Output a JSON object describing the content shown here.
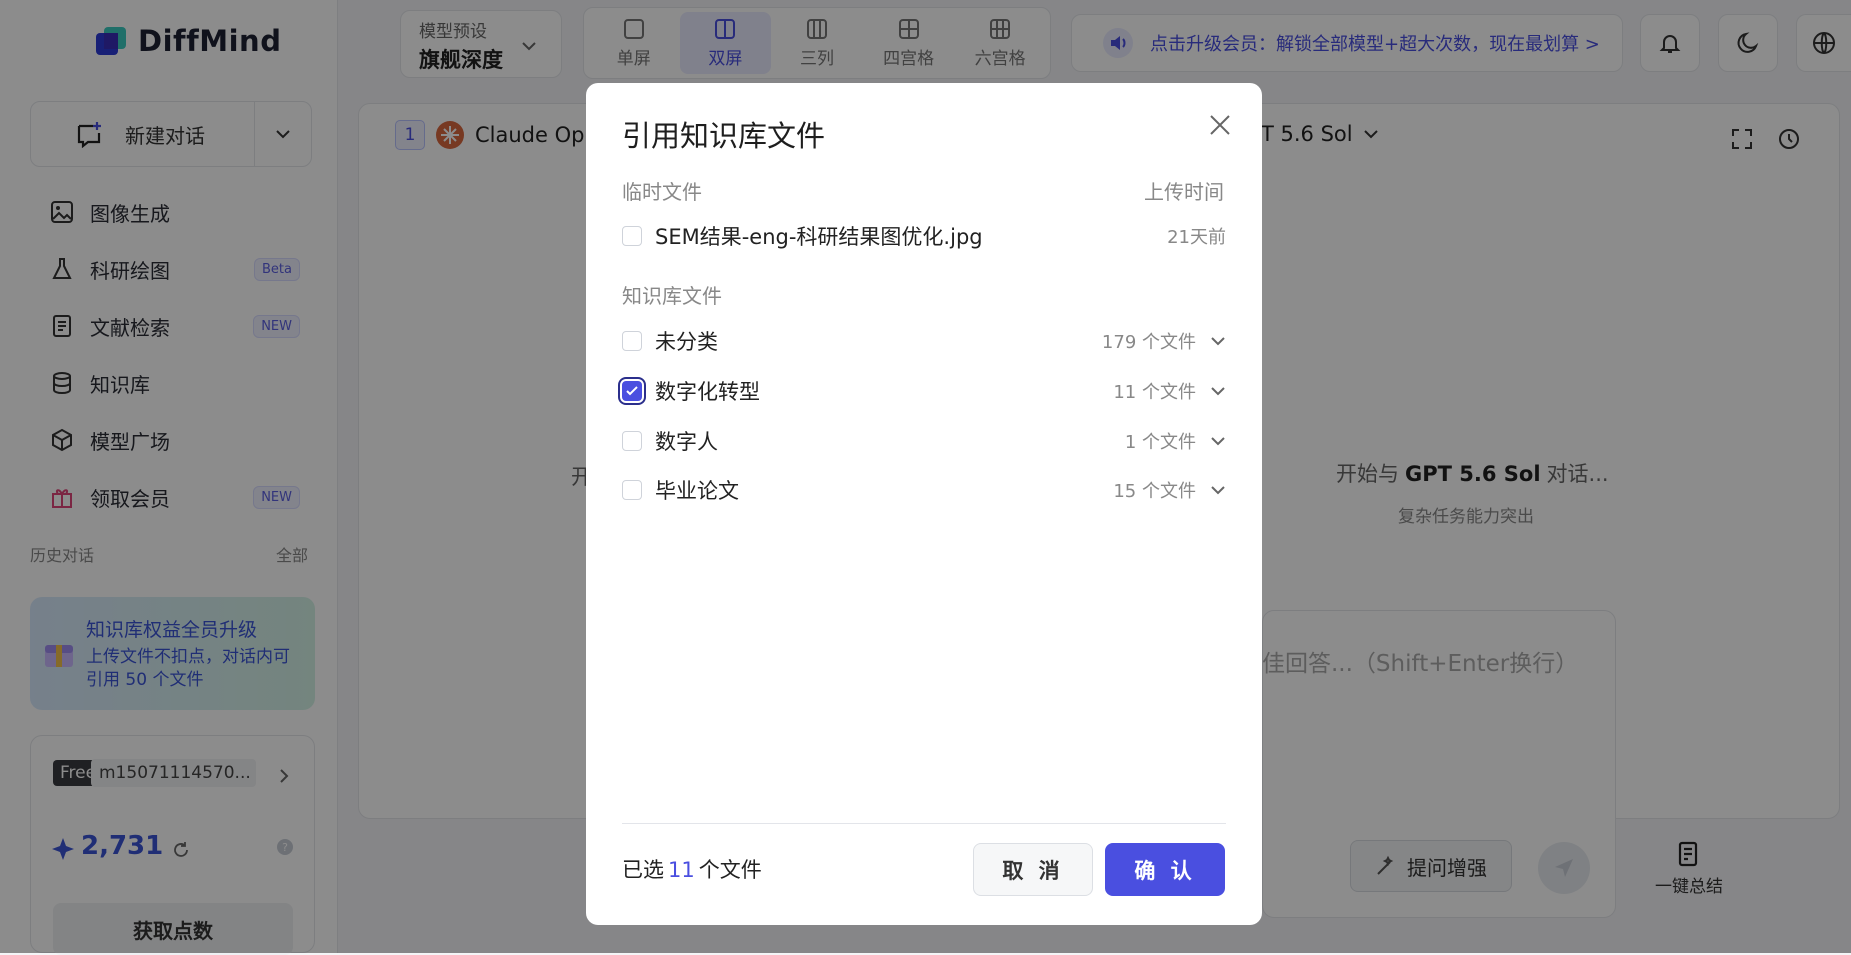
{
  "app": {
    "name": "DiffMind"
  },
  "sidebar": {
    "new_chat": "新建对话",
    "items": [
      {
        "label": "图像生成",
        "icon": "image-icon",
        "badge": ""
      },
      {
        "label": "科研绘图",
        "icon": "flask-icon",
        "badge": "Beta"
      },
      {
        "label": "文献检索",
        "icon": "document-icon",
        "badge": "NEW"
      },
      {
        "label": "知识库",
        "icon": "database-icon",
        "badge": ""
      },
      {
        "label": "模型广场",
        "icon": "cube-icon",
        "badge": ""
      },
      {
        "label": "领取会员",
        "icon": "gift-icon",
        "badge": "NEW"
      }
    ],
    "history_label": "历史对话",
    "history_all": "全部",
    "promo": {
      "title": "知识库权益全员升级",
      "line1": "上传文件不扣点，对话内可",
      "line2": "引用 50 个文件"
    },
    "user": {
      "plan": "Free",
      "name": "m15071114570...",
      "points": "2,731",
      "get_points": "获取点数"
    }
  },
  "topbar": {
    "preset_label": "模型预设",
    "preset_value": "旗舰深度",
    "layouts": [
      "单屏",
      "双屏",
      "三列",
      "四宫格",
      "六宫格"
    ],
    "active_layout": 1,
    "banner": "点击升级会员：解锁全部模型+超大次数，现在最划算 >"
  },
  "panels": {
    "left": {
      "index": "1",
      "model": "Claude Opu"
    },
    "right": {
      "model": "T 5.6 Sol",
      "start_prefix": "开",
      "start_text_a": "开始与",
      "start_model": "GPT 5.6 Sol",
      "start_text_b": "对话...",
      "sub": "复杂任务能力突出"
    },
    "input_placeholder": "佳回答...（Shift+Enter换行）",
    "enhance": "提问增强",
    "summary": "一键总结"
  },
  "modal": {
    "title": "引用知识库文件",
    "temp_section": "临时文件",
    "upload_time": "上传时间",
    "temp_files": [
      {
        "name": "SEM结果-eng-科研结果图优化.jpg",
        "time": "21天前",
        "checked": false
      }
    ],
    "kb_section": "知识库文件",
    "kb_folders": [
      {
        "name": "未分类",
        "count": "179 个文件",
        "checked": false
      },
      {
        "name": "数字化转型",
        "count": "11 个文件",
        "checked": true
      },
      {
        "name": "数字人",
        "count": "1 个文件",
        "checked": false
      },
      {
        "name": "毕业论文",
        "count": "15 个文件",
        "checked": false
      }
    ],
    "selected_prefix": "已选",
    "selected_count": "11",
    "selected_suffix": "个文件",
    "cancel": "取 消",
    "confirm": "确 认"
  },
  "colors": {
    "accent": "#4a4fe0",
    "overlay": "rgba(0,0,0,0.45)"
  }
}
